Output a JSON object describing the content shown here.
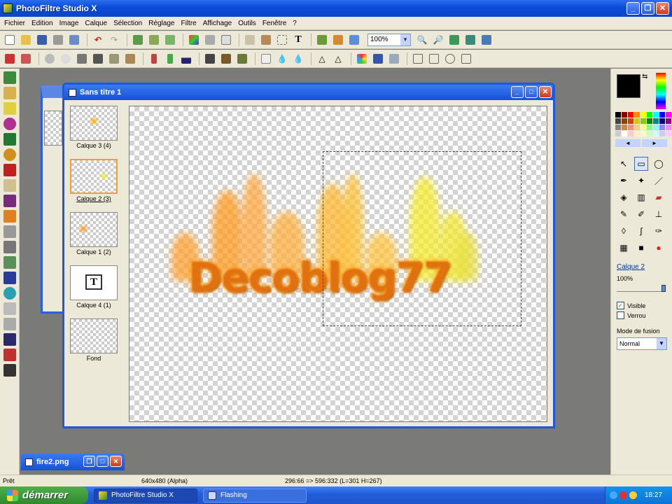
{
  "app": {
    "title": "PhotoFiltre Studio X"
  },
  "menu": [
    "Fichier",
    "Edition",
    "Image",
    "Calque",
    "Sélection",
    "Réglage",
    "Filtre",
    "Affichage",
    "Outils",
    "Fenêtre",
    "?"
  ],
  "toolbar": {
    "zoom_value": "100%"
  },
  "document": {
    "title": "Sans titre 1",
    "canvas_text": "Decoblog77",
    "layers": [
      {
        "label": "Calque 3 (4)",
        "selected": false
      },
      {
        "label": "Calque 2 (3)",
        "selected": true
      },
      {
        "label": "Calque 1 (2)",
        "selected": false
      },
      {
        "label": "Calque 4 (1)",
        "selected": false
      },
      {
        "label": "Fond",
        "selected": false
      }
    ]
  },
  "minimized_window": {
    "title": "fire2.png"
  },
  "right_panel": {
    "layer_name": "Calque 2",
    "opacity": "100%",
    "opacity_fraction": 1.0,
    "visible_label": "Visible",
    "visible_checked": true,
    "lock_label": "Verrou",
    "lock_checked": false,
    "blend_label": "Mode de fusion",
    "blend_value": "Normal"
  },
  "status": {
    "ready": "Prêt",
    "image_size": "640x480 (Alpha)",
    "selection_info": "296:66 => 596:332 (L=301  H=267)"
  },
  "taskbar": {
    "start_label": "démarrer",
    "tasks": [
      {
        "label": "PhotoFiltre Studio X",
        "active": true
      },
      {
        "label": "Flashing",
        "active": false
      }
    ],
    "clock": "18:27"
  },
  "colors": {
    "accent": "#1f58d8",
    "foreground": "#000000",
    "background": "#ffffff"
  }
}
